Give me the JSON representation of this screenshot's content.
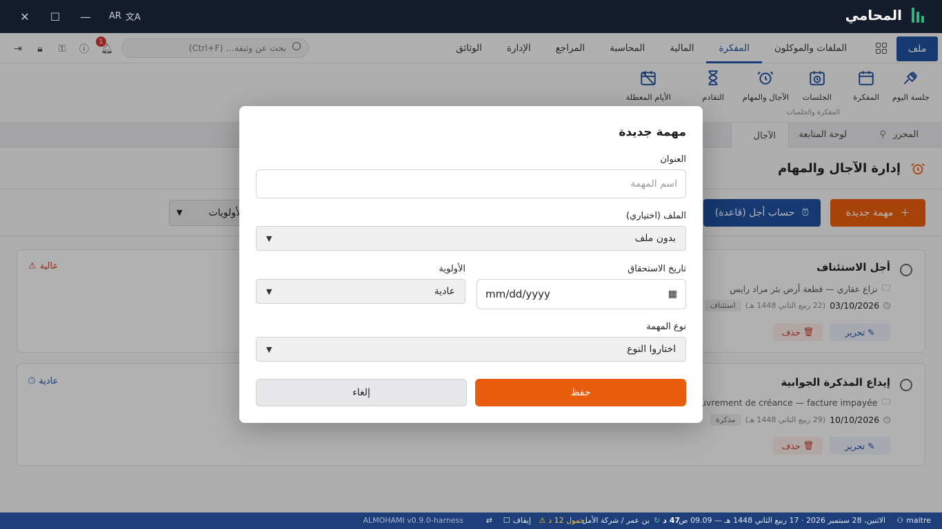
{
  "titlebar": {
    "app_name": "المحامي",
    "lang_label": "AR"
  },
  "menubar": {
    "file_label": "ملف",
    "tabs": [
      "الملفات والموكلون",
      "المفكرة",
      "المالية",
      "المحاسبة",
      "المراجع",
      "الإدارة",
      "الوثائق"
    ],
    "active_tab": "المفكرة",
    "search_placeholder": "بحث عن وثيقة… (Ctrl+F)",
    "notif_count": "1"
  },
  "ribbon": {
    "items": [
      "جلسة اليوم",
      "المفكرة",
      "الجلسات",
      "الآجال والمهام",
      "التقادم",
      "الأيام المعطلة"
    ],
    "group_label": "المفكرة والجلسات"
  },
  "doctabs": {
    "items": [
      "المحرر",
      "لوحة المتابعة",
      "الآجال"
    ]
  },
  "main": {
    "title": "إدارة الآجال والمهام",
    "new_task_label": "مهمة جديدة",
    "calc_label": "حساب أجل (قاعدة)",
    "priority_filter": "الأولويات",
    "cards": [
      {
        "title": "أجل الاستئناف",
        "file": "نزاع عقاري — قطعة أرض بئر مراد رايس",
        "date": "03/10/2026",
        "hijri": "(22 ربيع الثاني 1448 هـ)",
        "tag": "استئناف",
        "priority": "عالية",
        "edit": "تحرير",
        "delete": "حذف"
      },
      {
        "title": "إيداع المذكرة الجوابية",
        "file": "Recouvrement de créance — facture impayée",
        "date": "10/10/2026",
        "hijri": "(29 ربيع الثاني 1448 هـ)",
        "tag": "مذكرة",
        "priority": "عادية",
        "edit": "تحرير",
        "delete": "حذف"
      }
    ]
  },
  "statusbar": {
    "user": "maitre",
    "datetime": "الاثنين، 28 سبتمبر 2026 · 17 ربيع الثاني 1448 هـ — 09.09 ص",
    "count": "47 د",
    "firm": "بن عمر / شركة الأمل",
    "due": "حمول 12 د",
    "pause": "إيقاف",
    "version": "ALMOHAMI v0.9.0-harness"
  },
  "modal": {
    "title": "مهمة جديدة",
    "title_label": "العنوان",
    "title_placeholder": "اسم المهمة",
    "file_label": "الملف (اختياري)",
    "file_value": "بدون ملف",
    "due_label": "تاريخ الاستحقاق",
    "due_placeholder": "mm/dd/yyyy",
    "priority_label": "الأولوية",
    "priority_value": "عادية",
    "type_label": "نوع المهمة",
    "type_value": "اختاروا النوع",
    "save_label": "حفظ",
    "cancel_label": "إلغاء"
  },
  "colors": {
    "accent": "#e85d0d",
    "primary": "#1e4f9c",
    "titlebar": "#141b2d",
    "danger": "#c0392b"
  }
}
